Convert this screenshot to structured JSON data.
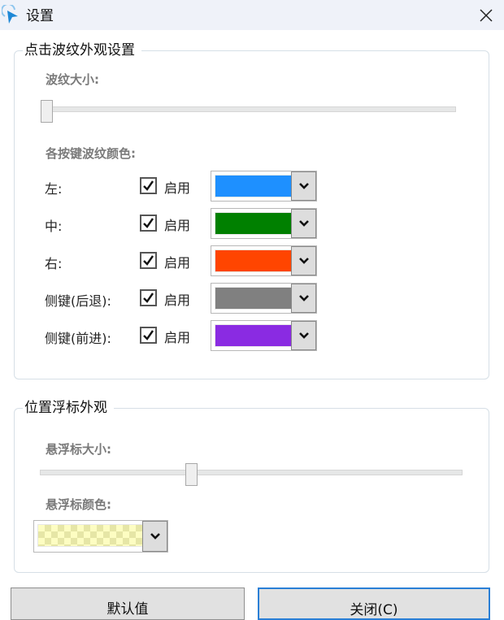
{
  "window": {
    "title": "设置",
    "icon": "cursor-ripple-icon",
    "close_icon": "close-icon"
  },
  "ripple_group": {
    "legend": "点击波纹外观设置",
    "size_label": "波纹大小:",
    "size_value_fraction": 0.0,
    "colors_label": "各按键波纹颜色:",
    "rows": [
      {
        "label": "左:",
        "enabled": true,
        "enable_label": "启用",
        "color": "#1e90ff"
      },
      {
        "label": "中:",
        "enabled": true,
        "enable_label": "启用",
        "color": "#008000"
      },
      {
        "label": "右:",
        "enabled": true,
        "enable_label": "启用",
        "color": "#ff4500"
      },
      {
        "label": "侧键(后退):",
        "enabled": true,
        "enable_label": "启用",
        "color": "#808080"
      },
      {
        "label": "侧键(前进):",
        "enabled": true,
        "enable_label": "启用",
        "color": "#8a2be2"
      }
    ]
  },
  "hover_group": {
    "legend": "位置浮标外观",
    "size_label": "悬浮标大小:",
    "size_value_fraction": 0.355,
    "color_label": "悬浮标颜色:",
    "color": "#ffffc0",
    "color_transparent": true
  },
  "buttons": {
    "default_label": "默认值",
    "close_label": "关闭(C)"
  }
}
